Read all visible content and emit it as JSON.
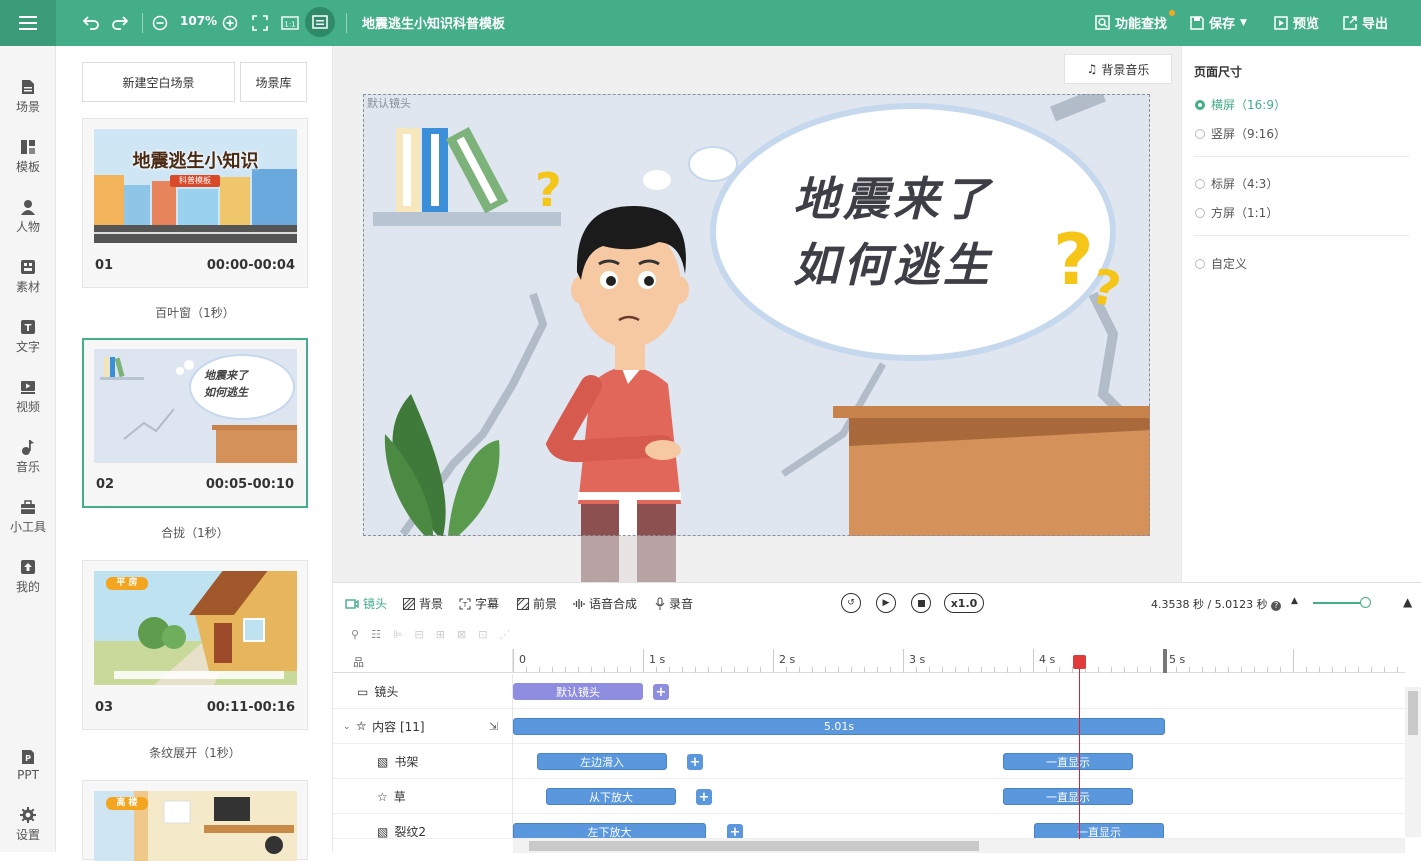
{
  "topbar": {
    "zoom": "107%",
    "doc_title": "地震逃生小知识科普模板",
    "feature_search": "功能查找",
    "save": "保存",
    "preview": "预览",
    "export": "导出",
    "accent": "#44ae88"
  },
  "nav": {
    "items": [
      {
        "label": "场景",
        "icon": "scene-icon"
      },
      {
        "label": "模板",
        "icon": "template-icon"
      },
      {
        "label": "人物",
        "icon": "person-icon"
      },
      {
        "label": "素材",
        "icon": "material-icon"
      },
      {
        "label": "文字",
        "icon": "text-icon"
      },
      {
        "label": "视频",
        "icon": "video-icon"
      },
      {
        "label": "音乐",
        "icon": "music-icon"
      },
      {
        "label": "小工具",
        "icon": "toolbox-icon"
      },
      {
        "label": "我的",
        "icon": "upload-icon"
      }
    ],
    "bottom": [
      {
        "label": "PPT",
        "icon": "ppt-icon"
      },
      {
        "label": "设置",
        "icon": "gear-icon"
      }
    ]
  },
  "scenes_panel": {
    "new_blank": "新建空白场景",
    "library": "场景库",
    "scenes": [
      {
        "num": "01",
        "time": "00:00-00:04",
        "transition": "百叶窗（1秒）",
        "thumb_title": "地震逃生小知识",
        "thumb_badge": "科普模板"
      },
      {
        "num": "02",
        "time": "00:05-00:10",
        "transition": "合拢（1秒）",
        "thumb_line1": "地震来了",
        "thumb_line2": "如何逃生"
      },
      {
        "num": "03",
        "time": "00:11-00:16",
        "transition": "条纹展开（1秒）",
        "thumb_badge": "平 房"
      },
      {
        "thumb_badge": "高 楼"
      }
    ]
  },
  "canvas": {
    "bg_music": "背景音乐",
    "default_camera": "默认镜头",
    "bubble_line1": "地震来了",
    "bubble_line2": "如何逃生"
  },
  "page_size": {
    "title": "页面尺寸",
    "options": [
      {
        "label": "横屏（16:9）",
        "selected": true
      },
      {
        "label": "竖屏（9:16）",
        "selected": false
      },
      {
        "label": "标屏（4:3）",
        "selected": false
      },
      {
        "label": "方屏（1:1）",
        "selected": false
      },
      {
        "label": "自定义",
        "selected": false
      }
    ]
  },
  "timeline": {
    "tools": [
      "镜头",
      "背景",
      "字幕",
      "前景",
      "语音合成",
      "录音"
    ],
    "speed": "x1.0",
    "time_info": "4.3538 秒 / 5.0123 秒",
    "ruler": [
      "0",
      "1 s",
      "2 s",
      "3 s",
      "4 s",
      "5 s"
    ],
    "playhead_seconds": 4.3538,
    "rows": [
      {
        "label": "镜头",
        "bars": [
          "默认镜头"
        ]
      },
      {
        "label": "内容 [11]",
        "bars": [
          "5.01s"
        ]
      },
      {
        "label": "书架",
        "bars": [
          "左边滑入",
          "一直显示"
        ]
      },
      {
        "label": "草",
        "bars": [
          "从下放大",
          "一直显示"
        ]
      },
      {
        "label": "裂纹2",
        "bars": [
          "左下放大",
          "一直显示"
        ]
      }
    ]
  }
}
